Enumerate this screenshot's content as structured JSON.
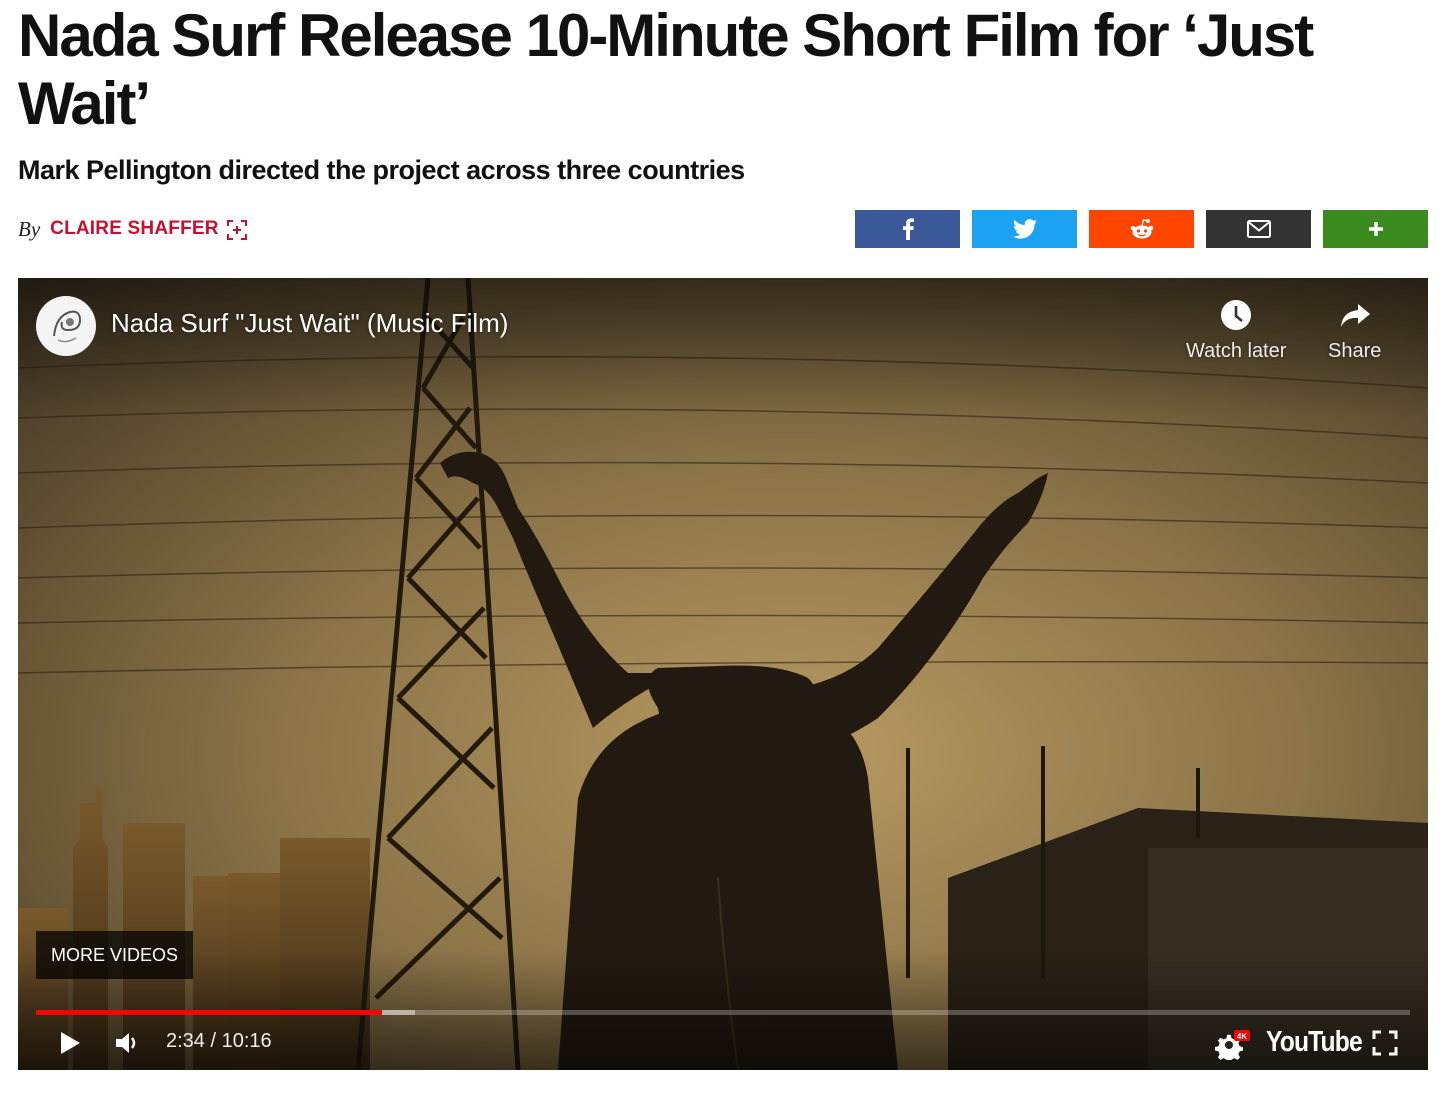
{
  "article": {
    "headline": "Nada Surf Release 10-Minute Short Film for ‘Just Wait’",
    "subhead": "Mark Pellington directed the project across three countries",
    "byline_prefix": "By",
    "author": "CLAIRE SHAFFER"
  },
  "share_buttons": [
    {
      "name": "facebook",
      "icon": "facebook-icon",
      "color": "#3b5998"
    },
    {
      "name": "twitter",
      "icon": "twitter-icon",
      "color": "#1da1f2"
    },
    {
      "name": "reddit",
      "icon": "reddit-icon",
      "color": "#ff4500"
    },
    {
      "name": "email",
      "icon": "email-icon",
      "color": "#333333"
    },
    {
      "name": "more",
      "icon": "plus-icon",
      "color": "#3b8a1f"
    }
  ],
  "video": {
    "title": "Nada Surf \"Just Wait\" (Music Film)",
    "watch_later": "Watch later",
    "share": "Share",
    "more_videos": "MORE VIDEOS",
    "time": "2:34 / 10:16",
    "played_fraction": 0.252,
    "buffered_fraction": 0.276,
    "quality_badge": "4K",
    "logo": "YouTube",
    "progress_color": "#ff0000"
  }
}
